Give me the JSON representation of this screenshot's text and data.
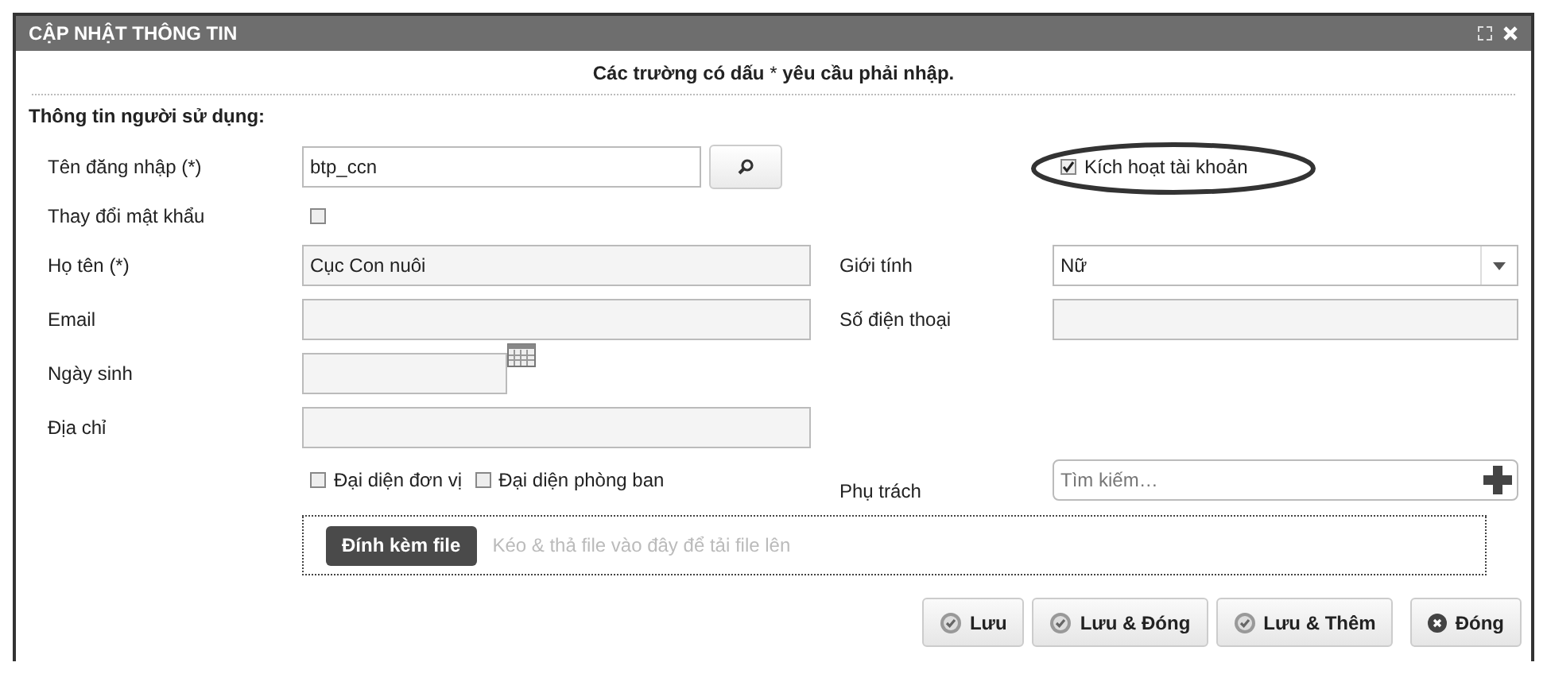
{
  "window": {
    "title": "CẬP NHẬT THÔNG TIN"
  },
  "notice": "**Các trường có dấu** * **yêu cầu phải nhập.**",
  "section_title": "Thông tin người sử dụng:",
  "form": {
    "username": {
      "label": "Tên đăng nhập (*)",
      "value": "btp_ccn"
    },
    "activate": {
      "label": "Kích hoạt tài khoản",
      "checked": true,
      "highlighted": true
    },
    "change_password": {
      "label": "Thay đổi mật khẩu",
      "checked": false
    },
    "full_name": {
      "label": "Họ tên (*)",
      "value": "Cục Con nuôi"
    },
    "gender": {
      "label": "Giới tính",
      "value": "Nữ"
    },
    "email": {
      "label": "Email"
    },
    "phone": {
      "label": "Số điện thoại"
    },
    "birth_date": {
      "label": "Ngày sinh"
    },
    "address": {
      "label": "Địa chỉ"
    },
    "representatives": [
      {
        "label": "Đại diện đơn vị",
        "checked": false
      },
      {
        "label": "Đại diện phòng ban",
        "checked": false
      }
    ],
    "in_charge": {
      "label": "Phụ trách",
      "placeholder": "Tìm kiếm…"
    }
  },
  "attachment": {
    "button": "Đính kèm file",
    "hint": "Kéo & thả file vào đây để tải file lên"
  },
  "buttons": [
    {
      "label": "Lưu",
      "kind": "save"
    },
    {
      "label": "Lưu & Đóng",
      "kind": "save"
    },
    {
      "label": "Lưu & Thêm",
      "kind": "save"
    },
    {
      "label": "Đóng",
      "kind": "close"
    }
  ]
}
